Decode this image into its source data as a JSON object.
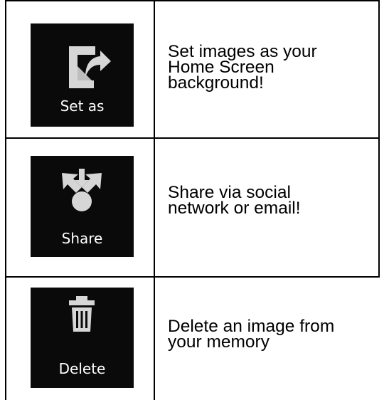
{
  "rows": [
    {
      "button_label": "Set as",
      "icon": "set-as-icon",
      "description_lines": [
        "Set images as your",
        "Home Screen",
        "background!"
      ]
    },
    {
      "button_label": "Share",
      "icon": "share-icon",
      "description_lines": [
        "Share via social",
        "network or email!"
      ]
    },
    {
      "button_label": "Delete",
      "icon": "trash-icon",
      "description_lines": [
        "Delete an image from",
        "your memory"
      ]
    }
  ],
  "colors": {
    "tile_background": "#0a0a0a",
    "icon": "#d6d6d6",
    "border": "#000000"
  }
}
